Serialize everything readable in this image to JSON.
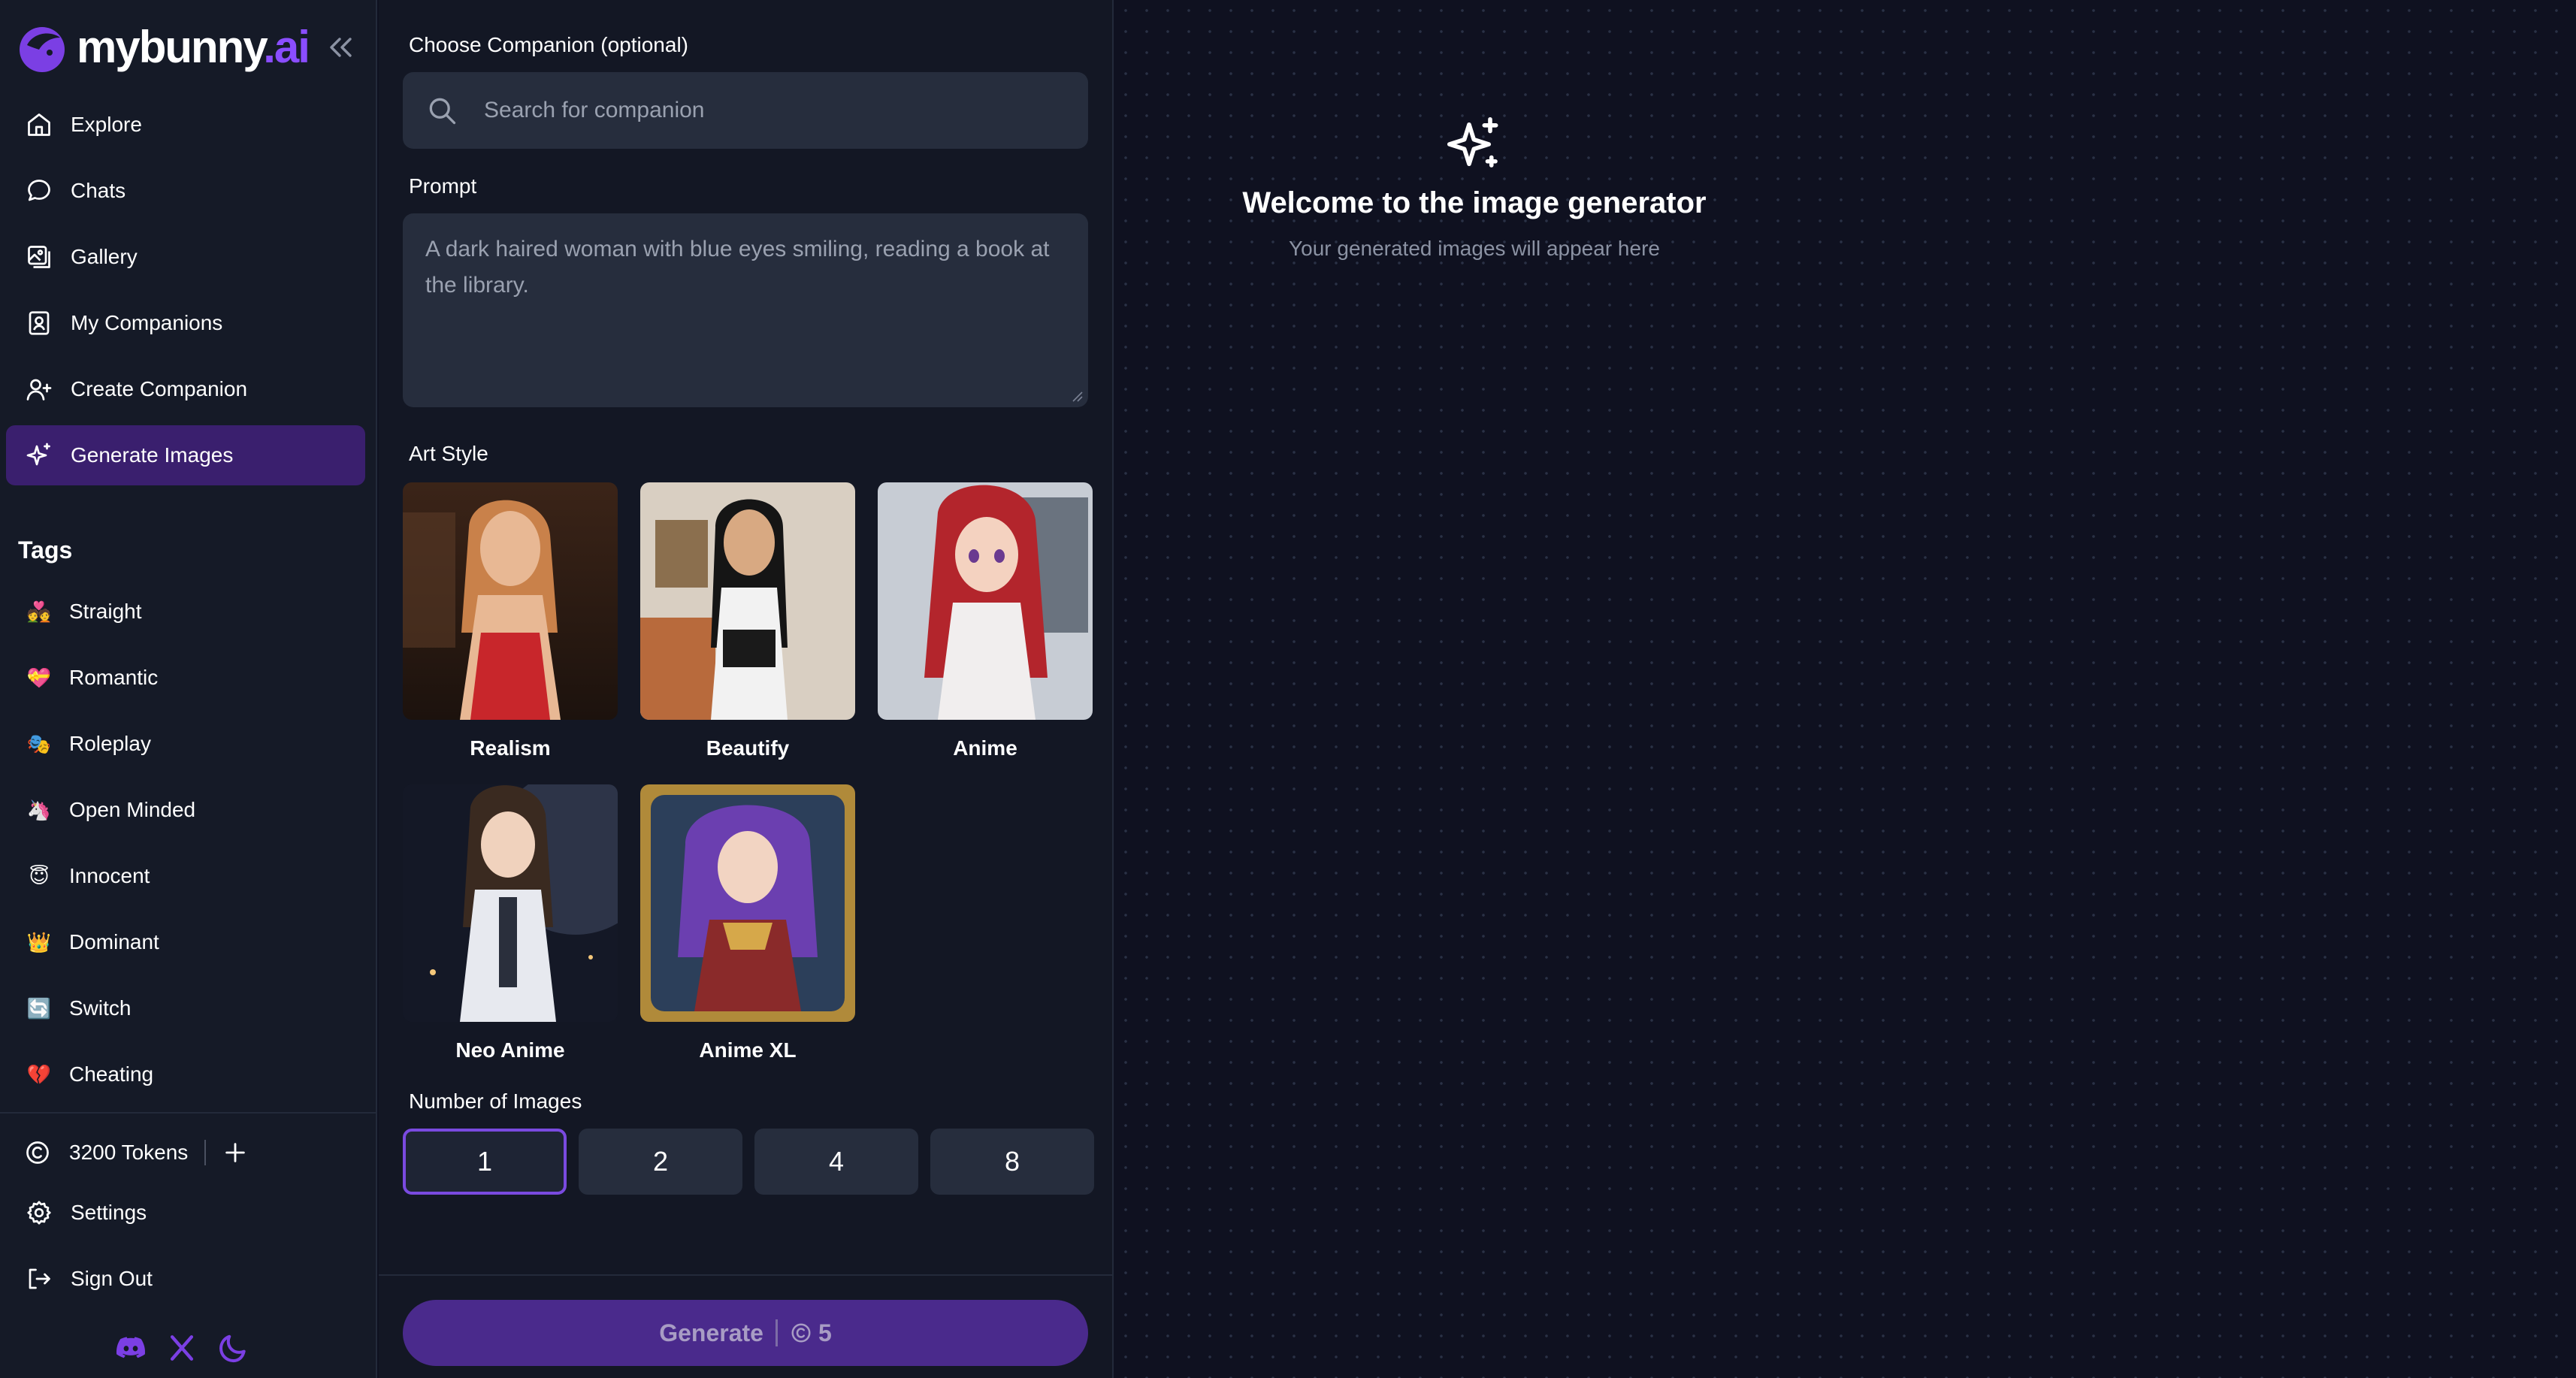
{
  "brand": {
    "part1": "mybunny",
    "part2": ".ai"
  },
  "colors": {
    "accent": "#8a4dff",
    "active_nav": "#3a1f6e",
    "generate_bg": "#4a2a8c"
  },
  "nav": [
    {
      "label": "Explore",
      "icon": "home-icon"
    },
    {
      "label": "Chats",
      "icon": "chat-bubble-icon"
    },
    {
      "label": "Gallery",
      "icon": "gallery-icon"
    },
    {
      "label": "My Companions",
      "icon": "companion-card-icon"
    },
    {
      "label": "Create Companion",
      "icon": "user-plus-icon"
    },
    {
      "label": "Generate Images",
      "icon": "sparkles-icon",
      "active": true
    }
  ],
  "tags": {
    "title": "Tags",
    "items": [
      {
        "label": "Straight",
        "emoji": "💑"
      },
      {
        "label": "Romantic",
        "emoji": "💝"
      },
      {
        "label": "Roleplay",
        "emoji": "🎭"
      },
      {
        "label": "Open Minded",
        "emoji": "🦄"
      },
      {
        "label": "Innocent",
        "emoji": "😇"
      },
      {
        "label": "Dominant",
        "emoji": "👑"
      },
      {
        "label": "Switch",
        "emoji": "🔄"
      },
      {
        "label": "Cheating",
        "emoji": "💔"
      }
    ]
  },
  "account": {
    "tokens_label": "3200 Tokens",
    "settings_label": "Settings",
    "signout_label": "Sign Out"
  },
  "form": {
    "companion_label": "Choose Companion (optional)",
    "search_placeholder": "Search for companion",
    "prompt_label": "Prompt",
    "prompt_placeholder": "A dark haired woman with blue eyes smiling, reading a book at the library.",
    "art_style_label": "Art Style",
    "styles": [
      {
        "name": "Realism"
      },
      {
        "name": "Beautify"
      },
      {
        "name": "Anime"
      },
      {
        "name": "Neo Anime"
      },
      {
        "name": "Anime XL"
      }
    ],
    "count_label": "Number of Images",
    "counts": [
      "1",
      "2",
      "4",
      "8"
    ],
    "selected_count": "1",
    "generate_label": "Generate",
    "generate_cost": "5"
  },
  "preview": {
    "title": "Welcome to the image generator",
    "subtitle": "Your generated images will appear here"
  }
}
